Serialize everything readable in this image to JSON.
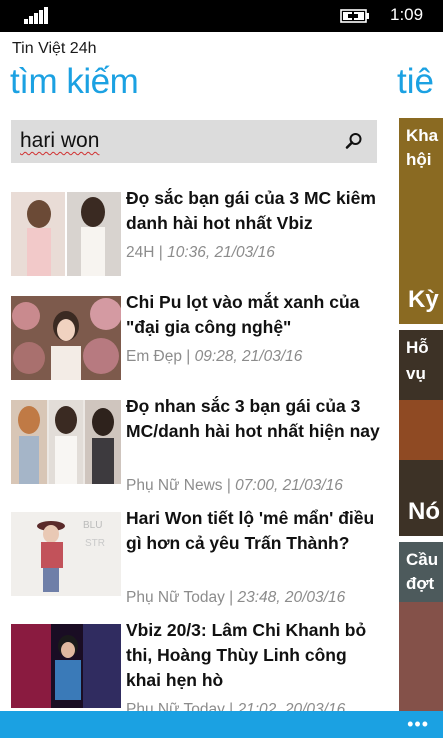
{
  "status": {
    "time": "1:09"
  },
  "app": {
    "name": "Tin Việt 24h"
  },
  "page": {
    "title": "tìm kiếm",
    "next_title": "tiê"
  },
  "search": {
    "value": "hari won"
  },
  "results": [
    {
      "title": "Đọ sắc bạn gái của 3 MC kiêm danh hài hot nhất Vbiz",
      "source": "24H",
      "sep": " | ",
      "time": "10:36, 21/03/16"
    },
    {
      "title": "Chi Pu lọt vào mắt xanh của \"đại gia công nghệ\"",
      "source": "Em Đẹp",
      "sep": " | ",
      "time": "09:28, 21/03/16"
    },
    {
      "title": "Đọ nhan sắc 3 bạn gái của 3 MC/danh hài hot nhất hiện nay",
      "source": "Phụ Nữ News",
      "sep": " | ",
      "time": "07:00, 21/03/16"
    },
    {
      "title": "Hari Won tiết lộ 'mê mẩn' điều gì hơn cả yêu Trấn Thành?",
      "source": "Phụ Nữ Today",
      "sep": " | ",
      "time": "23:48, 20/03/16"
    },
    {
      "title": "Vbiz 20/3: Lâm Chi Khanh bỏ thi, Hoàng Thùy Linh công khai hẹn hò",
      "source": "Phụ Nữ Today",
      "sep": " | ",
      "time": "21:02, 20/03/16"
    }
  ],
  "peek": [
    {
      "text": "Kha",
      "text2": "hội",
      "big": "Kỳ"
    },
    {
      "text": "Hỗ",
      "text2": "vụ",
      "big": "Nó"
    },
    {
      "text": "Cầu",
      "text2": "đợt",
      "big": ""
    }
  ],
  "appbar": {
    "more": "•••"
  },
  "colors": {
    "accent": "#1ba1e2",
    "meta": "#8c8c8c"
  }
}
